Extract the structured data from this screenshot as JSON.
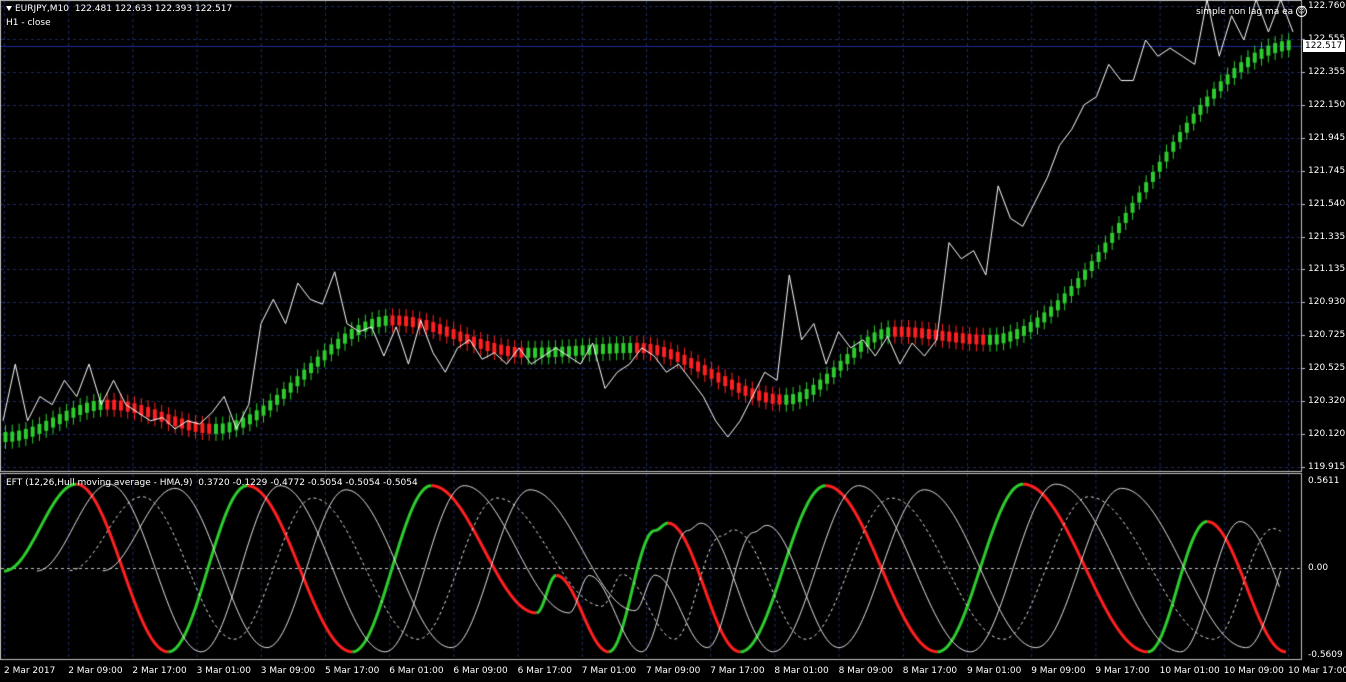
{
  "header": {
    "symbol": "EURJPY,M10",
    "ohlc": "122.481 122.633 122.393 122.517",
    "sub": "H1 - close",
    "ea_name": "simple non lag ma ea",
    "smiley_icon": "smiley-icon"
  },
  "current_price": "122.517",
  "indicator": {
    "title": "EFT (12,26,Hull moving average - HMA,9)",
    "values": "0.3720 -0.1229 -0.4772 -0.5054 -0.5054 -0.5054"
  },
  "colors": {
    "background": "#000000",
    "grid": "#1e2a66",
    "bull": "#2ecc2e",
    "bear": "#ff2020",
    "line": "#ffffff",
    "hline": "#1e2a99"
  },
  "price_axis": [
    "122.760",
    "122.555",
    "122.355",
    "122.150",
    "121.945",
    "121.745",
    "121.540",
    "121.335",
    "121.135",
    "120.930",
    "120.725",
    "120.525",
    "120.320",
    "120.120",
    "119.915"
  ],
  "ind_axis": [
    "0.5611",
    "0.00",
    "-0.5609"
  ],
  "time_axis": [
    "2 Mar 2017",
    "2 Mar 09:00",
    "2 Mar 17:00",
    "3 Mar 01:00",
    "3 Mar 09:00",
    "5 Mar 17:00",
    "6 Mar 01:00",
    "6 Mar 09:00",
    "6 Mar 17:00",
    "7 Mar 01:00",
    "7 Mar 09:00",
    "7 Mar 17:00",
    "8 Mar 01:00",
    "8 Mar 09:00",
    "8 Mar 17:00",
    "9 Mar 01:00",
    "9 Mar 09:00",
    "9 Mar 17:00",
    "10 Mar 01:00",
    "10 Mar 09:00",
    "10 Mar 17:00"
  ],
  "chart_data": {
    "type": "line",
    "price_range": [
      119.915,
      122.76
    ],
    "indicator_range": [
      -0.5609,
      0.5611
    ],
    "ma_segments": [
      {
        "color": "bull",
        "from": 120.1,
        "to": 120.3
      },
      {
        "color": "bear",
        "from": 120.3,
        "to": 120.15
      },
      {
        "color": "bull",
        "from": 120.15,
        "to": 120.82
      },
      {
        "color": "bear",
        "from": 120.82,
        "to": 120.62
      },
      {
        "color": "bull",
        "from": 120.62,
        "to": 120.65
      },
      {
        "color": "bear",
        "from": 120.65,
        "to": 120.33
      },
      {
        "color": "bull",
        "from": 120.33,
        "to": 120.75
      },
      {
        "color": "bear",
        "from": 120.75,
        "to": 120.7
      },
      {
        "color": "bull",
        "from": 120.7,
        "to": 122.52
      }
    ]
  }
}
